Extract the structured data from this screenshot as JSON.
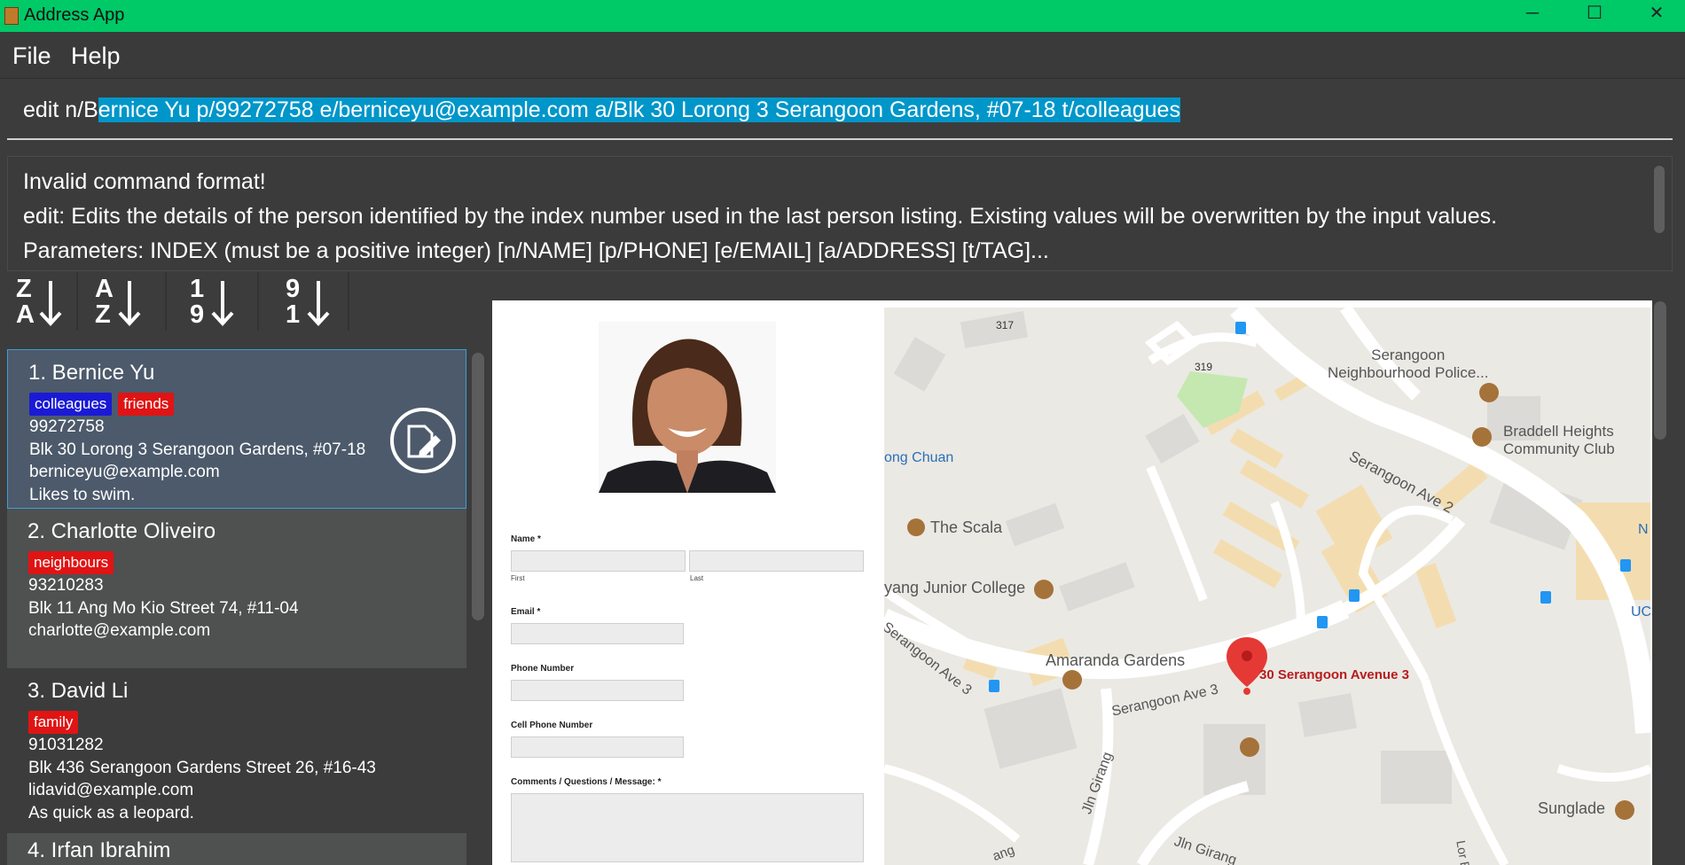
{
  "window": {
    "title": "Address App",
    "controls": [
      "─",
      "☐",
      "✕"
    ]
  },
  "menu": {
    "file": "File",
    "help": "Help"
  },
  "command": {
    "prefix": "edit n/B",
    "selected": "ernice Yu p/99272758 e/berniceyu@example.com a/Blk 30 Lorong 3 Serangoon Gardens, #07-18 t/colleagues"
  },
  "result": {
    "line1": "Invalid command format!",
    "line2": "edit: Edits the details of the person identified by the index number used in the last person listing. Existing values will be overwritten by the input values.",
    "line3": "Parameters: INDEX (must be a positive integer) [n/NAME] [p/PHONE] [e/EMAIL] [a/ADDRESS] [t/TAG]..."
  },
  "sort_buttons": [
    {
      "top": "Z",
      "bottom": "A"
    },
    {
      "top": "A",
      "bottom": "Z"
    },
    {
      "top": "1",
      "bottom": "9"
    },
    {
      "top": "9",
      "bottom": "1"
    }
  ],
  "persons": [
    {
      "index_name": "1.  Bernice Yu",
      "tags": [
        {
          "label": "colleagues",
          "color": "#1a1ad6"
        },
        {
          "label": "friends",
          "color": "#e01414"
        }
      ],
      "phone": "99272758",
      "address": "Blk 30 Lorong 3 Serangoon Gardens, #07-18",
      "email": "berniceyu@example.com",
      "remark": "Likes to swim."
    },
    {
      "index_name": "2.  Charlotte Oliveiro",
      "tags": [
        {
          "label": "neighbours",
          "color": "#e01414"
        }
      ],
      "phone": "93210283",
      "address": "Blk 11 Ang Mo Kio Street 74, #11-04",
      "email": "charlotte@example.com",
      "remark": ""
    },
    {
      "index_name": "3.  David Li",
      "tags": [
        {
          "label": "family",
          "color": "#e01414"
        }
      ],
      "phone": "91031282",
      "address": "Blk 436 Serangoon Gardens Street 26, #16-43",
      "email": "lidavid@example.com",
      "remark": "As quick as a leopard."
    },
    {
      "index_name": "4.  Irfan Ibrahim"
    }
  ],
  "form": {
    "name_label": "Name *",
    "first": "First",
    "last": "Last",
    "email_label": "Email *",
    "phone_label": "Phone Number",
    "cell_label": "Cell Phone Number",
    "comments_label": "Comments / Questions / Message: *"
  },
  "map": {
    "labels": {
      "n317": "317",
      "n319": "319",
      "police": "Serangoon\nNeighbourhood Police...",
      "braddell": "Braddell Heights\nCommunity Club",
      "ave2": "Serangoon Ave 2",
      "ongchuan": "ong Chuan",
      "scala": "The Scala",
      "yjc": "yang Junior College",
      "amaranda": "Amaranda Gardens",
      "ave3a": "Serangoon Ave 3",
      "ave3b": "Serangoon Ave 3",
      "marker": "30 Serangoon Avenue 3",
      "jlngirang1": "Jln Girang",
      "jlngirang2": "Jln Girang",
      "sunglade": "Sunglade",
      "uc": "UC",
      "n": "N",
      "ang": "ang",
      "lorb": "Lor B"
    },
    "colors": {
      "land": "#ebe9e4",
      "road": "#ffffff",
      "building": "#dcdad6",
      "park": "#c5e8b0",
      "highlight": "#f3ddb0",
      "poi": "#a5723a",
      "marker": "#e53935"
    }
  }
}
